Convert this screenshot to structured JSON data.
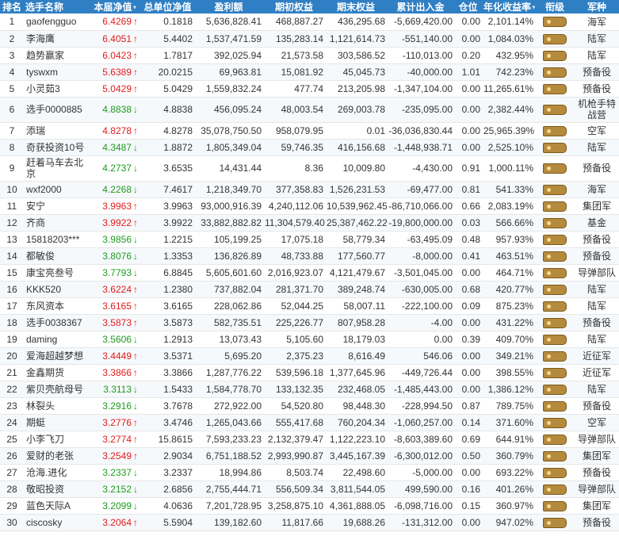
{
  "headers": {
    "rank": "排名",
    "name": "选手名称",
    "nav": "本届净值",
    "unit_nav": "总单位净值",
    "profit": "盈利额",
    "start_equity": "期初权益",
    "end_equity": "期末权益",
    "net_flow": "累计出入金",
    "position": "仓位",
    "annual": "年化收益率",
    "rank_title": "衔级",
    "army": "军种"
  },
  "sort_icon": "▼",
  "arrow_up": "↑",
  "arrow_down": "↓",
  "colors": {
    "header_bg": "#2f7fc4",
    "up": "#e21b1b",
    "down": "#1e9b1e",
    "badge": "#b58a3c"
  },
  "rows": [
    {
      "rank": "1",
      "name": "gaofengguo",
      "nav": "6.4269",
      "dir": "up",
      "unit_nav": "0.1818",
      "profit": "5,636,828.41",
      "start": "468,887.27",
      "end": "436,295.68",
      "flow": "-5,669,420.00",
      "pos": "0.00",
      "annual": "2,101.14%",
      "army": "海军"
    },
    {
      "rank": "2",
      "name": "李海鹰",
      "nav": "6.4051",
      "dir": "up",
      "unit_nav": "5.4402",
      "profit": "1,537,471.59",
      "start": "135,283.14",
      "end": "1,121,614.73",
      "flow": "-551,140.00",
      "pos": "0.00",
      "annual": "1,084.03%",
      "army": "陆军"
    },
    {
      "rank": "3",
      "name": "趋势赢家",
      "nav": "6.0423",
      "dir": "up",
      "unit_nav": "1.7817",
      "profit": "392,025.94",
      "start": "21,573.58",
      "end": "303,586.52",
      "flow": "-110,013.00",
      "pos": "0.20",
      "annual": "432.95%",
      "army": "陆军"
    },
    {
      "rank": "4",
      "name": "tyswxm",
      "nav": "5.6389",
      "dir": "up",
      "unit_nav": "20.0215",
      "profit": "69,963.81",
      "start": "15,081.92",
      "end": "45,045.73",
      "flow": "-40,000.00",
      "pos": "1.01",
      "annual": "742.23%",
      "army": "预备役"
    },
    {
      "rank": "5",
      "name": "小灵茹3",
      "nav": "5.0429",
      "dir": "up",
      "unit_nav": "5.0429",
      "profit": "1,559,832.24",
      "start": "477.74",
      "end": "213,205.98",
      "flow": "-1,347,104.00",
      "pos": "0.00",
      "annual": "11,265.61%",
      "army": "预备役"
    },
    {
      "rank": "6",
      "name": "选手0000885",
      "nav": "4.8838",
      "dir": "down",
      "unit_nav": "4.8838",
      "profit": "456,095.24",
      "start": "48,003.54",
      "end": "269,003.78",
      "flow": "-235,095.00",
      "pos": "0.00",
      "annual": "2,382.44%",
      "army": "机枪手特战营",
      "tall": true
    },
    {
      "rank": "7",
      "name": "添瑞",
      "nav": "4.8278",
      "dir": "up",
      "unit_nav": "4.8278",
      "profit": "35,078,750.50",
      "start": "958,079.95",
      "end": "0.01",
      "flow": "-36,036,830.44",
      "pos": "0.00",
      "annual": "25,965.39%",
      "army": "空军"
    },
    {
      "rank": "8",
      "name": "奇获投资10号",
      "nav": "4.3487",
      "dir": "down",
      "unit_nav": "1.8872",
      "profit": "1,805,349.04",
      "start": "59,746.35",
      "end": "416,156.68",
      "flow": "-1,448,938.71",
      "pos": "0.00",
      "annual": "2,525.10%",
      "army": "陆军"
    },
    {
      "rank": "9",
      "name": "赶着马车去北京",
      "nav": "4.2737",
      "dir": "down",
      "unit_nav": "3.6535",
      "profit": "14,431.44",
      "start": "8.36",
      "end": "10,009.80",
      "flow": "-4,430.00",
      "pos": "0.91",
      "annual": "1,000.11%",
      "army": "预备役",
      "tall": true
    },
    {
      "rank": "10",
      "name": "wxf2000",
      "nav": "4.2268",
      "dir": "down",
      "unit_nav": "7.4617",
      "profit": "1,218,349.70",
      "start": "377,358.83",
      "end": "1,526,231.53",
      "flow": "-69,477.00",
      "pos": "0.81",
      "annual": "541.33%",
      "army": "海军"
    },
    {
      "rank": "11",
      "name": "安宁",
      "nav": "3.9963",
      "dir": "up",
      "unit_nav": "3.9963",
      "profit": "93,000,916.39",
      "start": "4,240,112.06",
      "end": "10,539,962.45",
      "flow": "-86,710,066.00",
      "pos": "0.66",
      "annual": "2,083.19%",
      "army": "集团军"
    },
    {
      "rank": "12",
      "name": "齐商",
      "nav": "3.9922",
      "dir": "up",
      "unit_nav": "3.9922",
      "profit": "33,882,882.82",
      "start": "11,304,579.40",
      "end": "25,387,462.22",
      "flow": "-19,800,000.00",
      "pos": "0.03",
      "annual": "566.66%",
      "army": "基金"
    },
    {
      "rank": "13",
      "name": "15818203***",
      "nav": "3.9856",
      "dir": "down",
      "unit_nav": "1.2215",
      "profit": "105,199.25",
      "start": "17,075.18",
      "end": "58,779.34",
      "flow": "-63,495.09",
      "pos": "0.48",
      "annual": "957.93%",
      "army": "预备役"
    },
    {
      "rank": "14",
      "name": "都敏俊",
      "nav": "3.8076",
      "dir": "down",
      "unit_nav": "1.3353",
      "profit": "136,826.89",
      "start": "48,733.88",
      "end": "177,560.77",
      "flow": "-8,000.00",
      "pos": "0.41",
      "annual": "463.51%",
      "army": "预备役"
    },
    {
      "rank": "15",
      "name": "康宝亮叁号",
      "nav": "3.7793",
      "dir": "down",
      "unit_nav": "6.8845",
      "profit": "5,605,601.60",
      "start": "2,016,923.07",
      "end": "4,121,479.67",
      "flow": "-3,501,045.00",
      "pos": "0.00",
      "annual": "464.71%",
      "army": "导弹部队"
    },
    {
      "rank": "16",
      "name": "KKK520",
      "nav": "3.6224",
      "dir": "up",
      "unit_nav": "1.2380",
      "profit": "737,882.04",
      "start": "281,371.70",
      "end": "389,248.74",
      "flow": "-630,005.00",
      "pos": "0.68",
      "annual": "420.77%",
      "army": "陆军"
    },
    {
      "rank": "17",
      "name": "东风资本",
      "nav": "3.6165",
      "dir": "up",
      "unit_nav": "3.6165",
      "profit": "228,062.86",
      "start": "52,044.25",
      "end": "58,007.11",
      "flow": "-222,100.00",
      "pos": "0.09",
      "annual": "875.23%",
      "army": "陆军"
    },
    {
      "rank": "18",
      "name": "选手0038367",
      "nav": "3.5873",
      "dir": "up",
      "unit_nav": "3.5873",
      "profit": "582,735.51",
      "start": "225,226.77",
      "end": "807,958.28",
      "flow": "-4.00",
      "pos": "0.00",
      "annual": "431.22%",
      "army": "预备役"
    },
    {
      "rank": "19",
      "name": "daming",
      "nav": "3.5606",
      "dir": "down",
      "unit_nav": "1.2913",
      "profit": "13,073.43",
      "start": "5,105.60",
      "end": "18,179.03",
      "flow": "0.00",
      "pos": "0.39",
      "annual": "409.70%",
      "army": "陆军"
    },
    {
      "rank": "20",
      "name": "爱海超越梦想",
      "nav": "3.4449",
      "dir": "up",
      "unit_nav": "3.5371",
      "profit": "5,695.20",
      "start": "2,375.23",
      "end": "8,616.49",
      "flow": "546.06",
      "pos": "0.00",
      "annual": "349.21%",
      "army": "近征军"
    },
    {
      "rank": "21",
      "name": "金鑫期货",
      "nav": "3.3866",
      "dir": "up",
      "unit_nav": "3.3866",
      "profit": "1,287,776.22",
      "start": "539,596.18",
      "end": "1,377,645.96",
      "flow": "-449,726.44",
      "pos": "0.00",
      "annual": "398.55%",
      "army": "近征军"
    },
    {
      "rank": "22",
      "name": "紫贝壳航母号",
      "nav": "3.3113",
      "dir": "down",
      "unit_nav": "1.5433",
      "profit": "1,584,778.70",
      "start": "133,132.35",
      "end": "232,468.05",
      "flow": "-1,485,443.00",
      "pos": "0.00",
      "annual": "1,386.12%",
      "army": "陆军"
    },
    {
      "rank": "23",
      "name": "林裂头",
      "nav": "3.2916",
      "dir": "down",
      "unit_nav": "3.7678",
      "profit": "272,922.00",
      "start": "54,520.80",
      "end": "98,448.30",
      "flow": "-228,994.50",
      "pos": "0.87",
      "annual": "789.75%",
      "army": "预备役"
    },
    {
      "rank": "24",
      "name": "期蜓",
      "nav": "3.2776",
      "dir": "up",
      "unit_nav": "3.4746",
      "profit": "1,265,043.66",
      "start": "555,417.68",
      "end": "760,204.34",
      "flow": "-1,060,257.00",
      "pos": "0.14",
      "annual": "371.60%",
      "army": "空军"
    },
    {
      "rank": "25",
      "name": "小李飞刀",
      "nav": "3.2774",
      "dir": "up",
      "unit_nav": "15.8615",
      "profit": "7,593,233.23",
      "start": "2,132,379.47",
      "end": "1,122,223.10",
      "flow": "-8,603,389.60",
      "pos": "0.69",
      "annual": "644.91%",
      "army": "导弹部队"
    },
    {
      "rank": "26",
      "name": "爱财的老张",
      "nav": "3.2549",
      "dir": "up",
      "unit_nav": "2.9034",
      "profit": "6,751,188.52",
      "start": "2,993,990.87",
      "end": "3,445,167.39",
      "flow": "-6,300,012.00",
      "pos": "0.50",
      "annual": "360.79%",
      "army": "集团军"
    },
    {
      "rank": "27",
      "name": "沧海.进化",
      "nav": "3.2337",
      "dir": "down",
      "unit_nav": "3.2337",
      "profit": "18,994.86",
      "start": "8,503.74",
      "end": "22,498.60",
      "flow": "-5,000.00",
      "pos": "0.00",
      "annual": "693.22%",
      "army": "预备役"
    },
    {
      "rank": "28",
      "name": "敬昭投资",
      "nav": "3.2152",
      "dir": "down",
      "unit_nav": "2.6856",
      "profit": "2,755,444.71",
      "start": "556,509.34",
      "end": "3,811,544.05",
      "flow": "499,590.00",
      "pos": "0.16",
      "annual": "401.26%",
      "army": "导弹部队"
    },
    {
      "rank": "29",
      "name": "蓝色天际A",
      "nav": "3.2099",
      "dir": "down",
      "unit_nav": "4.0636",
      "profit": "7,201,728.95",
      "start": "3,258,875.10",
      "end": "4,361,888.05",
      "flow": "-6,098,716.00",
      "pos": "0.15",
      "annual": "360.97%",
      "army": "集团军"
    },
    {
      "rank": "30",
      "name": "ciscosky",
      "nav": "3.2064",
      "dir": "up",
      "unit_nav": "5.5904",
      "profit": "139,182.60",
      "start": "11,817.66",
      "end": "19,688.26",
      "flow": "-131,312.00",
      "pos": "0.00",
      "annual": "947.02%",
      "army": "预备役"
    }
  ]
}
